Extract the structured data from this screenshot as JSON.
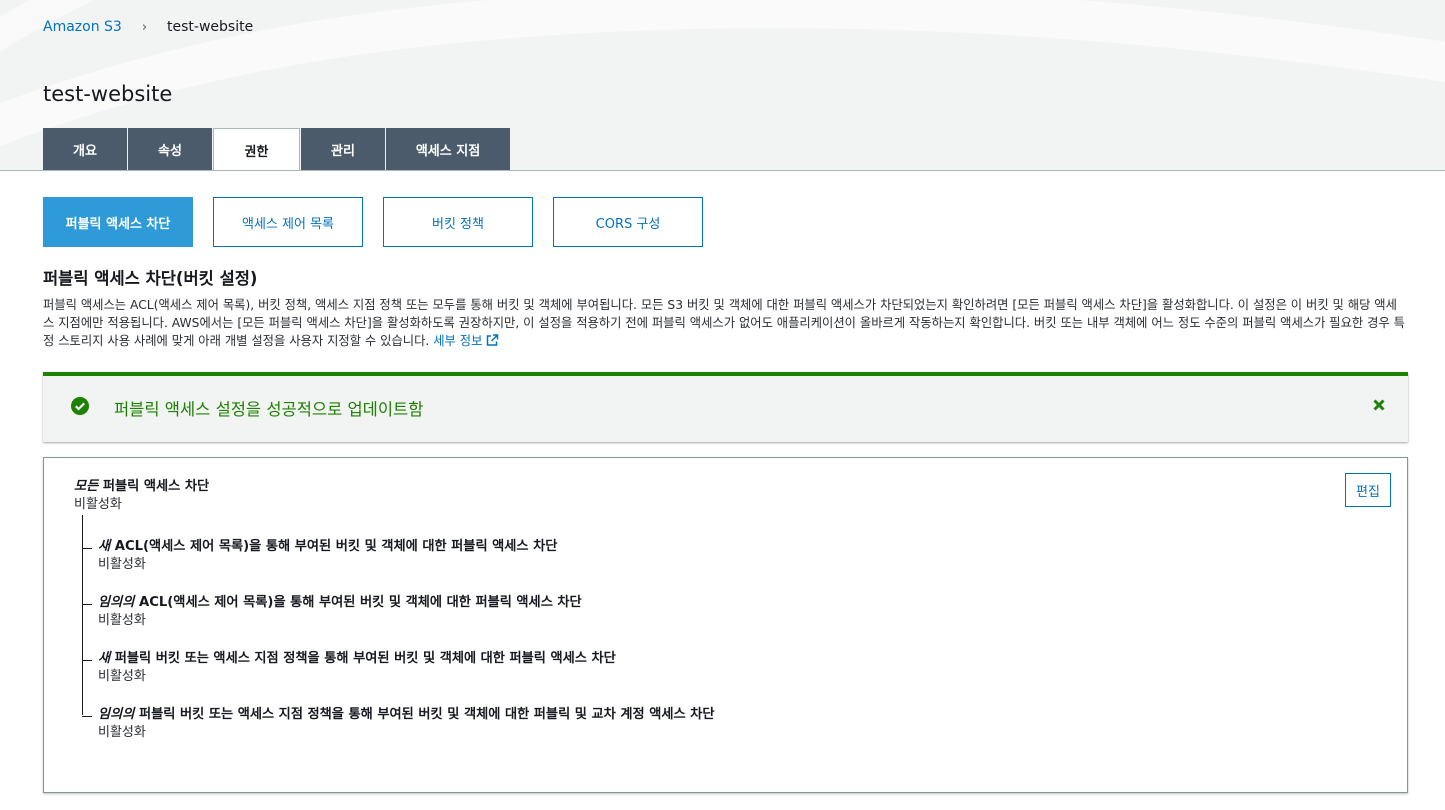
{
  "breadcrumb": {
    "root": "Amazon S3",
    "separator": "›",
    "current": "test-website"
  },
  "page_title": "test-website",
  "tabs": [
    {
      "label": "개요",
      "active": false
    },
    {
      "label": "속성",
      "active": false
    },
    {
      "label": "권한",
      "active": true
    },
    {
      "label": "관리",
      "active": false
    },
    {
      "label": "액세스 지점",
      "active": false
    }
  ],
  "subtabs": [
    {
      "label": "퍼블릭 액세스 차단",
      "active": true
    },
    {
      "label": "액세스 제어 목록",
      "active": false
    },
    {
      "label": "버킷 정책",
      "active": false
    },
    {
      "label": "CORS 구성",
      "active": false
    }
  ],
  "section": {
    "heading": "퍼블릭 액세스 차단(버킷 설정)",
    "description": "퍼블릭 액세스는 ACL(액세스 제어 목록), 버킷 정책, 액세스 지점 정책 또는 모두를 통해 버킷 및 객체에 부여됩니다. 모든 S3 버킷 및 객체에 대한 퍼블릭 액세스가 차단되었는지 확인하려면 [모든 퍼블릭 액세스 차단]을 활성화합니다. 이 설정은 이 버킷 및 해당 액세스 지점에만 적용됩니다. AWS에서는 [모든 퍼블릭 액세스 차단]을 활성화하도록 권장하지만, 이 설정을 적용하기 전에 퍼블릭 액세스가 없어도 애플리케이션이 올바르게 작동하는지 확인합니다. 버킷 또는 내부 객체에 어느 정도 수준의 퍼블릭 액세스가 필요한 경우 특정 스토리지 사용 사례에 맞게 아래 개별 설정을 사용자 지정할 수 있습니다. ",
    "info_link": "세부 정보"
  },
  "alert": {
    "message": "퍼블릭 액세스 설정을 성공적으로 업데이트함",
    "type": "success",
    "color": "#1d8102"
  },
  "settings": {
    "edit_label": "편집",
    "main": {
      "emphasis": "모든",
      "title": " 퍼블릭 액세스 차단",
      "value": "비활성화"
    },
    "items": [
      {
        "emphasis": "새",
        "title": " ACL(액세스 제어 목록)을 통해 부여된 버킷 및 객체에 대한 퍼블릭 액세스 차단",
        "value": "비활성화"
      },
      {
        "emphasis": "임의의",
        "title": " ACL(액세스 제어 목록)을 통해 부여된 버킷 및 객체에 대한 퍼블릭 액세스 차단",
        "value": "비활성화"
      },
      {
        "emphasis": "새",
        "title": " 퍼블릭 버킷 또는 액세스 지점 정책을 통해 부여된 버킷 및 객체에 대한 퍼블릭 액세스 차단",
        "value": "비활성화"
      },
      {
        "emphasis": "임의의",
        "title": " 퍼블릭 버킷 또는 액세스 지점 정책을 통해 부여된 버킷 및 객체에 대한 퍼블릭 및 교차 계정 액세스 차단",
        "value": "비활성화"
      }
    ]
  },
  "colors": {
    "accent": "#0073bb",
    "tab_bg": "#4b5b6b",
    "subtab_active": "#2e9ad8",
    "success": "#1d8102"
  }
}
